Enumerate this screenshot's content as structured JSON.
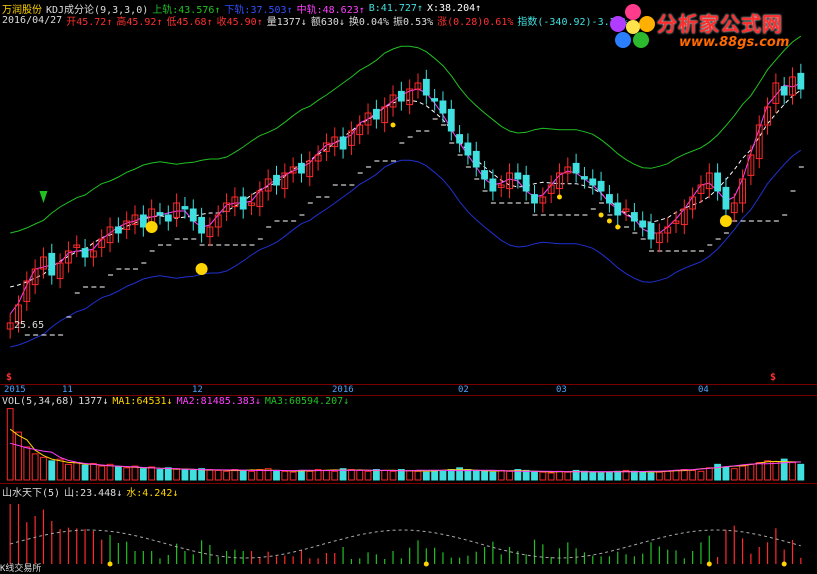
{
  "main_header": {
    "stock_name": "万润股份",
    "indicator": "KDJ成分论(9,3,3,0)",
    "k_label": "上轨:43.576↑",
    "d_label": "下轨:37.503↑",
    "j_label": "中轨:48.623↑",
    "b_label": "B:41.727↑",
    "x_label": "X:38.204↑"
  },
  "quote_line": {
    "date": "2016/04/27",
    "open": "开45.72↑",
    "high": "高45.92↑",
    "low": "低45.68↑",
    "close": "收45.90↑",
    "volume": "量1377↓",
    "amount": "额630↓",
    "turnover": "换0.04%",
    "amplitude": "振0.53%",
    "change": "涨(0.28)0.61%",
    "index": "指数(-340.92)-3.23%"
  },
  "price_low_label": "25.65",
  "x_axis": [
    "2015",
    "11",
    "12",
    "2016",
    "02",
    "03",
    "04"
  ],
  "vol_header": {
    "name": "VOL(5,34,68)",
    "value": "1377↓",
    "ma1": "MA1:64531↓",
    "ma2": "MA2:81485.383↓",
    "ma3": "MA3:60594.207↓"
  },
  "ss_header": {
    "name": "山水天下(5)",
    "shan": "山:23.448↓",
    "shui": "水:4.242↓"
  },
  "footer_label": "K线交易所",
  "logo": {
    "title": "分析家公式网",
    "url": "www.88gs.com"
  },
  "colors": {
    "upper_band": "#22c022",
    "lower_band": "#2030d0",
    "up_candle": "#ff2a2a",
    "down_candle": "#40e0e0",
    "accent_yellow": "#ffd400"
  },
  "chart_data": {
    "type": "candlestick",
    "closes": [
      22,
      25,
      29,
      31,
      33,
      30,
      32,
      34,
      35,
      33,
      34,
      36,
      38,
      37,
      39,
      40,
      38,
      41,
      40,
      39,
      42,
      41,
      39,
      37,
      38,
      40,
      42,
      43,
      41,
      42,
      44,
      46,
      45,
      47,
      48,
      47,
      49,
      50,
      52,
      53,
      51,
      54,
      55,
      57,
      56,
      58,
      60,
      59,
      61,
      62,
      60,
      59,
      57,
      54,
      52,
      50,
      48,
      46,
      44,
      45,
      47,
      46,
      44,
      42,
      43,
      45,
      47,
      48,
      47,
      46,
      45,
      44,
      42,
      40,
      41,
      39,
      38,
      36,
      37,
      38,
      39,
      41,
      43,
      45,
      47,
      44,
      41,
      42,
      46,
      50,
      55,
      58,
      62,
      60,
      63,
      61
    ],
    "volume": [
      82,
      55,
      38,
      30,
      26,
      22,
      24,
      18,
      20,
      17,
      19,
      16,
      18,
      15,
      14,
      16,
      13,
      15,
      12,
      14,
      13,
      12,
      11,
      13,
      12,
      11,
      10,
      12,
      11,
      10,
      12,
      13,
      11,
      10,
      9,
      11,
      10,
      12,
      11,
      10,
      13,
      12,
      11,
      10,
      12,
      11,
      10,
      12,
      11,
      10,
      9,
      11,
      10,
      12,
      14,
      12,
      11,
      10,
      9,
      11,
      10,
      12,
      11,
      10,
      9,
      8,
      10,
      9,
      11,
      10,
      9,
      8,
      9,
      10,
      11,
      10,
      9,
      8,
      9,
      10,
      11,
      12,
      11,
      10,
      14,
      18,
      15,
      13,
      16,
      18,
      20,
      22,
      21,
      24,
      20,
      18
    ]
  }
}
